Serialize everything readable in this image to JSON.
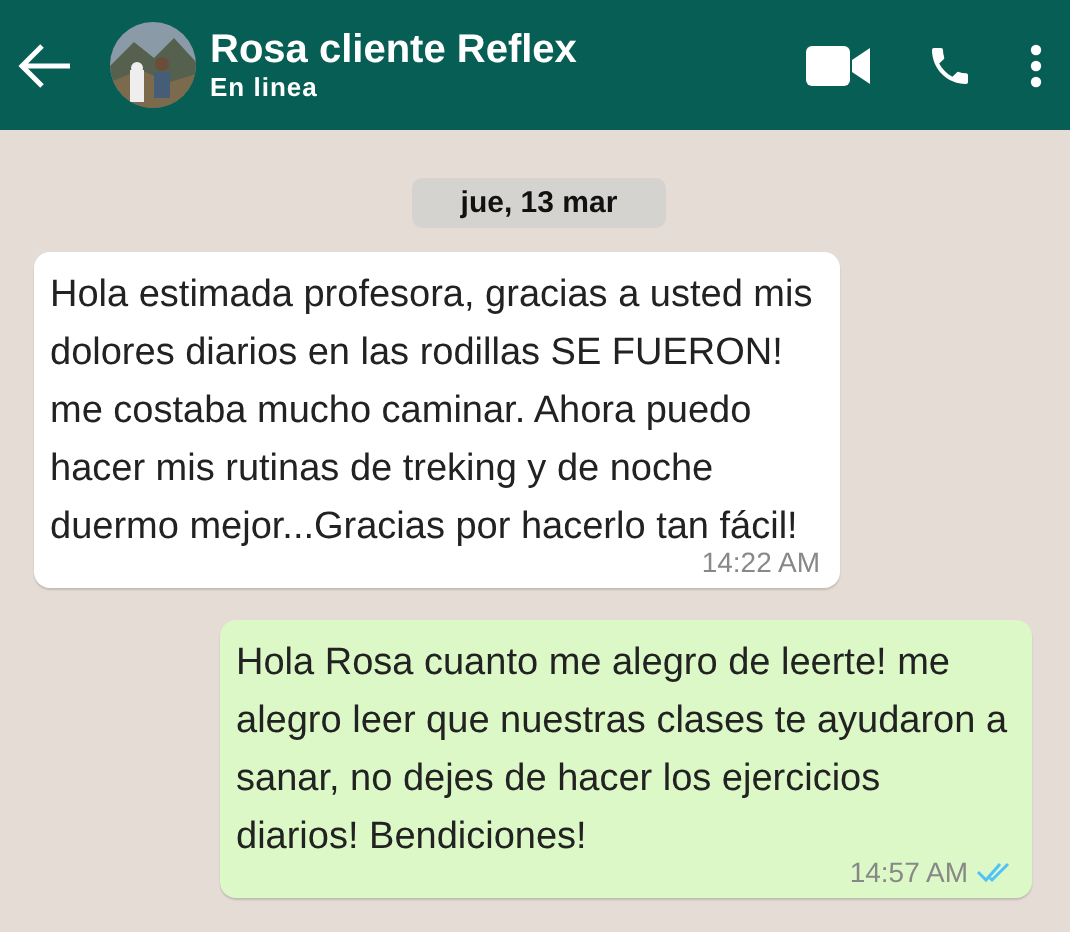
{
  "header": {
    "title": "Rosa cliente Reflex",
    "status": "En linea"
  },
  "date_chip": "jue, 13 mar",
  "messages": [
    {
      "kind": "incoming",
      "text": "Hola estimada profesora, gracias a usted mis dolores diarios en las rodillas SE FUERON! me costaba mucho caminar. Ahora puedo hacer mis rutinas de treking y de noche duermo mejor...Gracias por hacerlo tan fácil!",
      "time": "14:22 AM",
      "read": false
    },
    {
      "kind": "outgoing",
      "text": "Hola Rosa cuanto me alegro de leerte! me alegro leer que nuestras clases te ayudaron a sanar, no dejes de hacer los ejercicios diarios! Bendiciones!",
      "time": "14:57 AM",
      "read": true
    }
  ]
}
